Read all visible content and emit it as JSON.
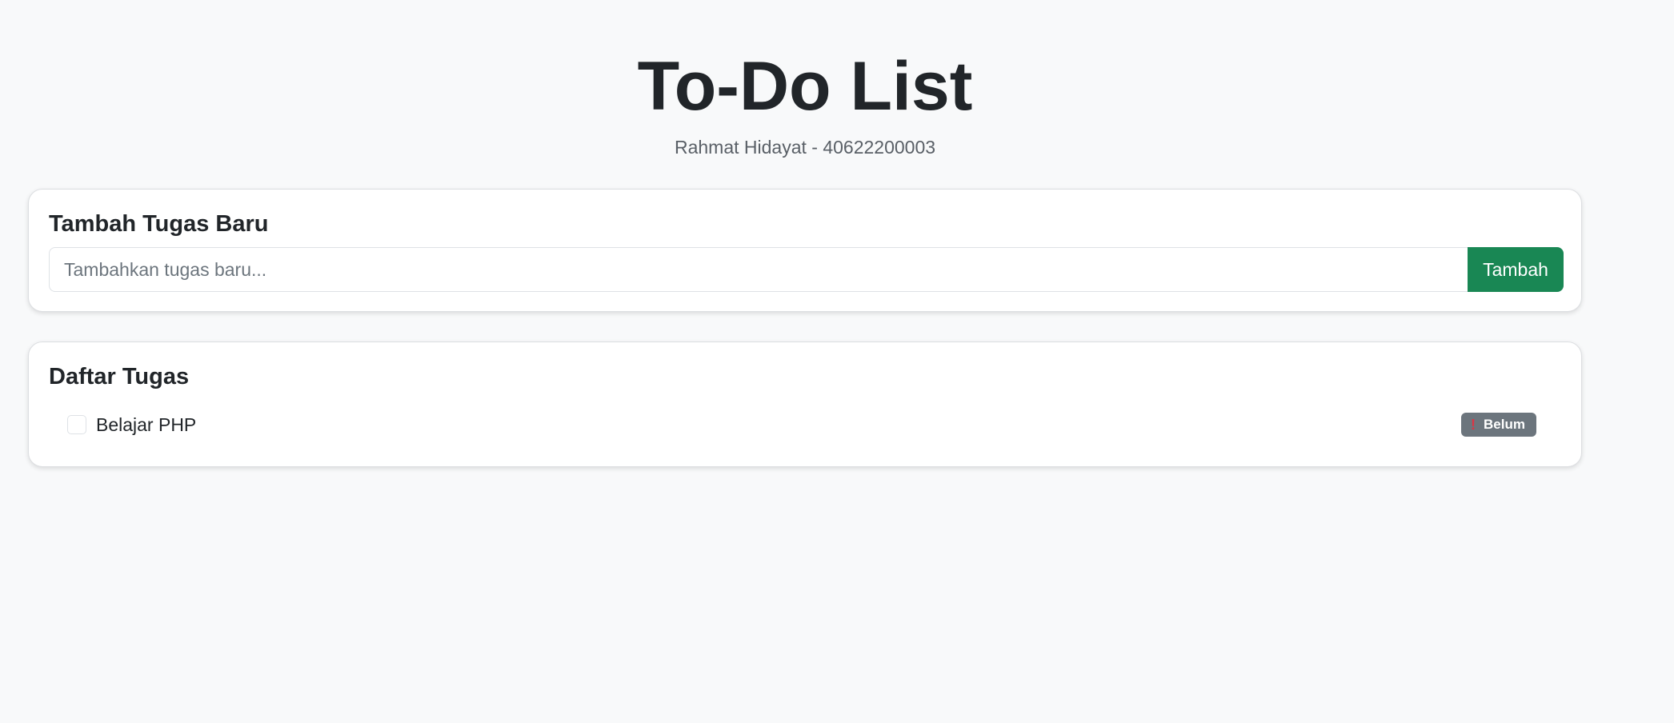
{
  "header": {
    "title": "To-Do List",
    "subtitle": "Rahmat Hidayat - 40622200003"
  },
  "add_task": {
    "title": "Tambah Tugas Baru",
    "input_value": "",
    "input_placeholder": "Tambahkan tugas baru...",
    "button_label": "Tambah"
  },
  "task_list": {
    "title": "Daftar Tugas",
    "items": [
      {
        "label": "Belajar PHP",
        "checked": false,
        "status_icon": "exclamation-icon",
        "status_label": "Belum"
      }
    ]
  },
  "colors": {
    "background": "#f8f9fa",
    "primary_button": "#198754",
    "badge": "#6c757d",
    "badge_icon": "#dc3545"
  }
}
